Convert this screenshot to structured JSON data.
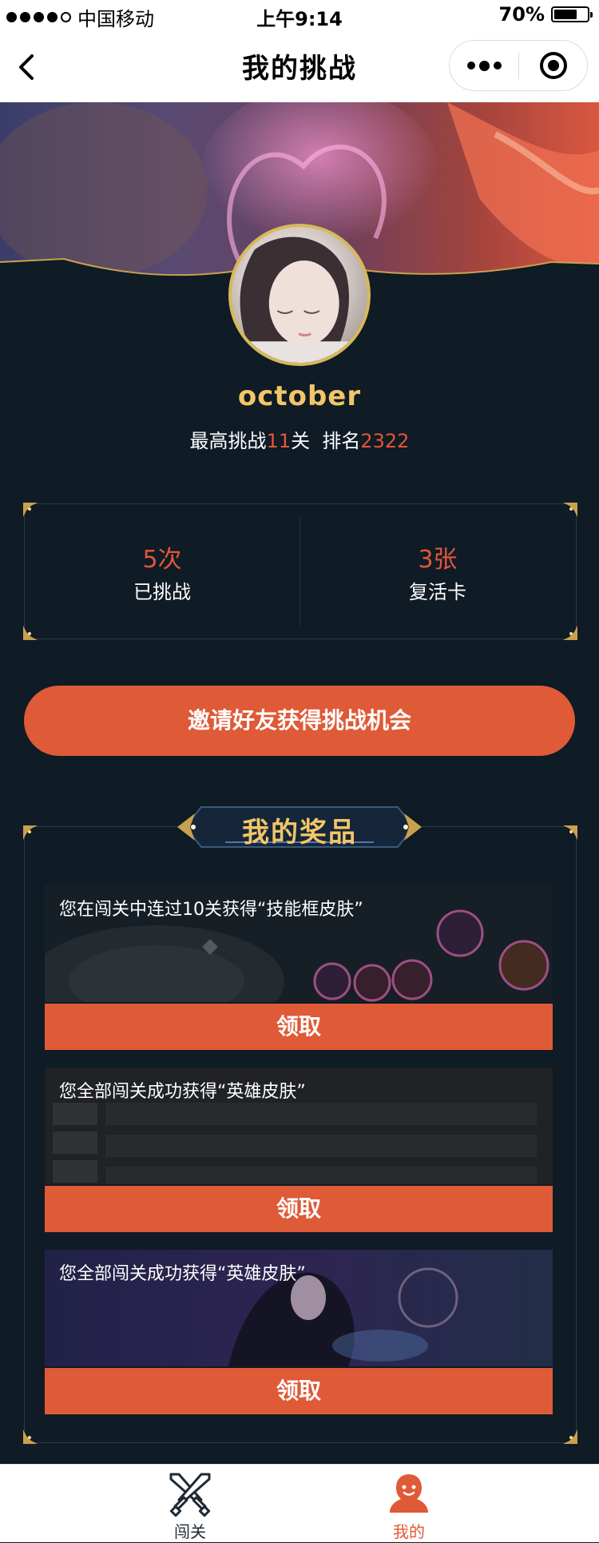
{
  "status_bar": {
    "carrier": "中国移动",
    "time": "上午9:14",
    "battery": "70%",
    "battery_level": 0.7
  },
  "nav": {
    "title": "我的挑战",
    "back_icon": "chevron-left-icon",
    "more_icon": "more-dots-icon",
    "close_icon": "target-icon"
  },
  "profile": {
    "username": "october",
    "highest_label": "最高挑战",
    "highest_value": "11",
    "level_unit": "关",
    "rank_label": "排名",
    "rank_value": "2322"
  },
  "stats": [
    {
      "value": "5次",
      "label": "已挑战"
    },
    {
      "value": "3张",
      "label": "复活卡"
    }
  ],
  "invite_button": "邀请好友获得挑战机会",
  "prizes": {
    "title": "我的奖品",
    "items": [
      {
        "text": "您在闯关中连过10关获得“技能框皮肤”",
        "button": "领取"
      },
      {
        "text": "您全部闯关成功获得“英雄皮肤”",
        "button": "领取"
      },
      {
        "text": "您全部闯关成功获得“英雄皮肤”",
        "button": "领取"
      }
    ]
  },
  "tab_bar": {
    "items": [
      {
        "label": "闯关",
        "icon": "crossed-swords-icon",
        "active": false
      },
      {
        "label": "我的",
        "icon": "person-icon",
        "active": true
      }
    ]
  },
  "colors": {
    "accent": "#df5a37",
    "gold": "#f2c667",
    "background": "#0f1b25",
    "highlight": "#e4553a"
  }
}
